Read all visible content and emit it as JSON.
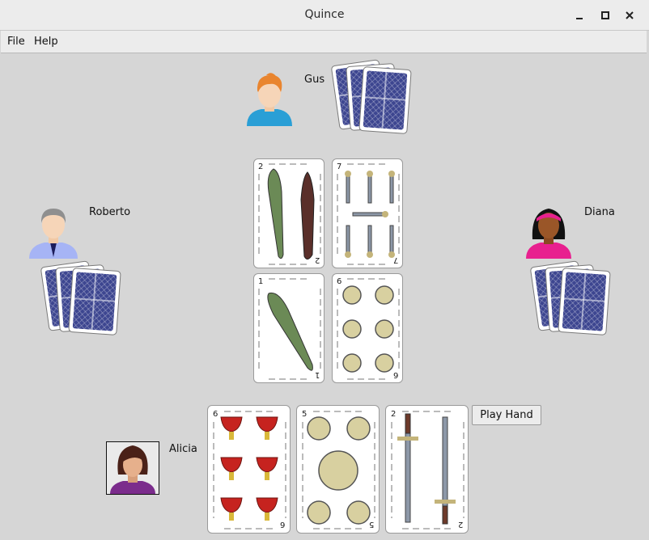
{
  "window": {
    "title": "Quince"
  },
  "menu": {
    "file": "File",
    "help": "Help"
  },
  "players": {
    "top": {
      "name": "Gus"
    },
    "left": {
      "name": "Roberto"
    },
    "right": {
      "name": "Diana"
    },
    "bottom": {
      "name": "Alicia"
    }
  },
  "table_cards": [
    {
      "rank": "2",
      "suit": "bastos"
    },
    {
      "rank": "7",
      "suit": "espadas"
    },
    {
      "rank": "1",
      "suit": "bastos"
    },
    {
      "rank": "6",
      "suit": "oros"
    }
  ],
  "hand_cards": [
    {
      "rank": "6",
      "suit": "copas"
    },
    {
      "rank": "5",
      "suit": "oros"
    },
    {
      "rank": "2",
      "suit": "espadas"
    }
  ],
  "buttons": {
    "play_hand": "Play Hand"
  },
  "colors": {
    "card_back": "#3d4690",
    "background": "#d6d6d6"
  }
}
